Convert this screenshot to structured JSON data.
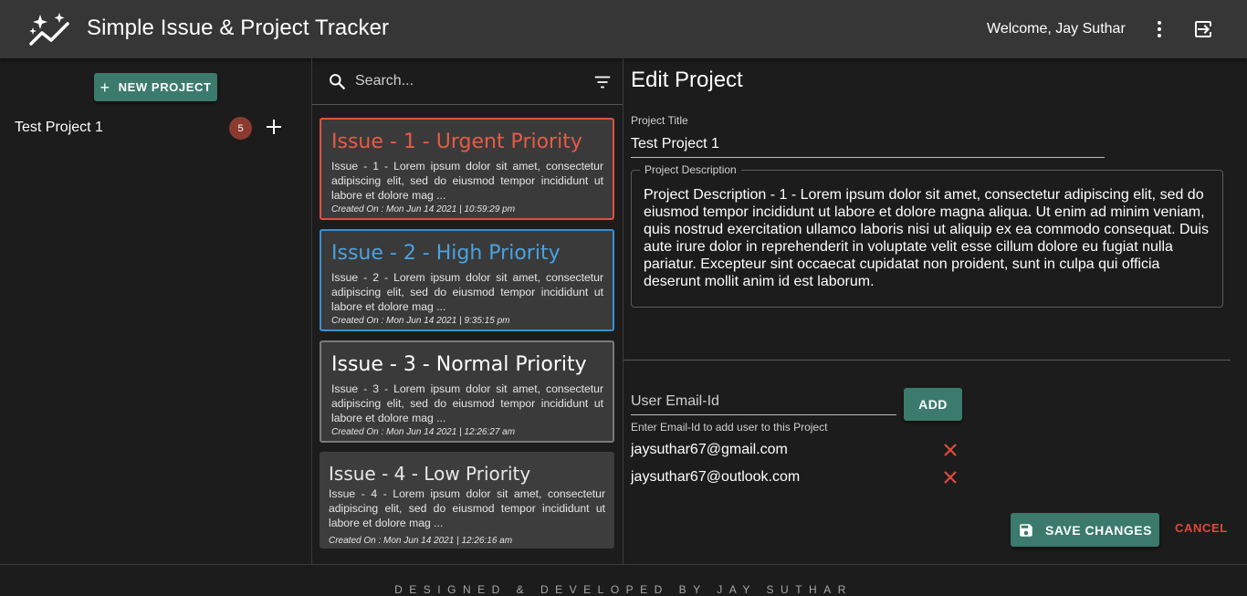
{
  "app": {
    "title": "Simple Issue & Project Tracker",
    "welcome": "Welcome, Jay Suthar"
  },
  "sidebar": {
    "new_project_label": "NEW PROJECT",
    "projects": [
      {
        "name": "Test Project 1",
        "issue_count": "5"
      }
    ]
  },
  "issues": {
    "search_placeholder": "Search...",
    "items": [
      {
        "title": "Issue - 1 - Urgent Priority",
        "description": "Issue - 1 - Lorem ipsum dolor sit amet, consectetur adipiscing elit, sed do eiusmod tempor incididunt ut labore et dolore mag ...",
        "created": "Created On : Mon Jun 14 2021 | 10:59:29 pm",
        "priority": "urgent",
        "color": "#e85b45"
      },
      {
        "title": "Issue - 2 - High Priority",
        "description": "Issue - 2 - Lorem ipsum dolor sit amet, consectetur adipiscing elit, sed do eiusmod tempor incididunt ut labore et dolore mag ...",
        "created": "Created On : Mon Jun 14 2021 | 9:35:15 pm",
        "priority": "high",
        "color": "#4aa2e0"
      },
      {
        "title": "Issue - 3 - Normal Priority",
        "description": "Issue - 3 - Lorem ipsum dolor sit amet, consectetur adipiscing elit, sed do eiusmod tempor incididunt ut labore et dolore mag ...",
        "created": "Created On : Mon Jun 14 2021 | 12:26:27 am",
        "priority": "normal",
        "color": "#ffffff"
      },
      {
        "title": "Issue - 4 - Low Priority",
        "description": "Issue - 4 - Lorem ipsum dolor sit amet, consectetur adipiscing elit, sed do eiusmod tempor incididunt ut labore et dolore mag ...",
        "created": "Created On : Mon Jun 14 2021 | 12:26:16 am",
        "priority": "low",
        "color": "#e8e8e8"
      }
    ]
  },
  "editor": {
    "heading": "Edit Project",
    "title_label": "Project Title",
    "title_value": "Test Project 1",
    "description_label": "Project Description",
    "description_value": "Project Description -  1 - Lorem ipsum dolor sit amet, consectetur adipiscing elit, sed do eiusmod tempor incididunt ut labore et dolore magna aliqua. Ut enim ad minim veniam, quis nostrud exercitation ullamco laboris nisi ut aliquip ex ea commodo consequat. Duis aute irure dolor in reprehenderit in voluptate velit esse cillum dolore eu fugiat nulla pariatur. Excepteur sint occaecat cupidatat non proident, sunt in culpa qui officia deserunt mollit anim id est laborum.",
    "email_placeholder": "User Email-Id",
    "add_label": "ADD",
    "email_help": "Enter Email-Id to add user to this Project",
    "users": [
      "jaysuthar67@gmail.com",
      "jaysuthar67@outlook.com"
    ],
    "save_label": "SAVE CHANGES",
    "cancel_label": "CANCEL"
  },
  "footer": {
    "credit": "DESIGNED & DEVELOPED BY JAY SUTHAR"
  },
  "colors": {
    "accent": "#3b7a6c",
    "danger": "#e04a3a",
    "appbar": "#363636",
    "background": "#1c1c1c"
  }
}
